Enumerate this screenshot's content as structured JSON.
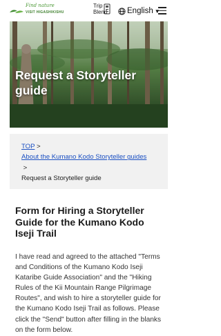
{
  "header": {
    "logo_script": "Find nature",
    "logo_text": "VISIT HIGASHIKISHU",
    "trip_top": "Trip",
    "trip_bottom": "Blend",
    "language": "English",
    "language_caret": "▼"
  },
  "hero": {
    "title": "Request a Storyteller guide"
  },
  "breadcrumb": {
    "top": "TOP",
    "sep1": " >",
    "about": "About the Kumano Kodo Storyteller guides",
    "sep2": ">",
    "current": "Request a Storyteller guide"
  },
  "main": {
    "title": "Form for Hiring a Storyteller Guide for the Kumano Kodo Iseji Trail",
    "body": "I have read and agreed to the attached \"Terms and Conditions of the Kumano Kodo Iseji Kataribe Guide Association\" and the \"Hiking Rules of the Kii Mountain Range Pilgrimage Routes\", and wish to hire a storyteller guide for the Kumano Kodo Iseji Trail as follows. Please click the \"Send\" button after filling in the blanks on the form below."
  },
  "colors": {
    "link": "#1a4fc2",
    "brand_green": "#4f9a3a",
    "breadcrumb_bg": "#f1f1f1"
  },
  "icons": [
    "leaf-logo-icon",
    "trip-blend-icon",
    "globe-icon",
    "hamburger-menu-icon"
  ]
}
